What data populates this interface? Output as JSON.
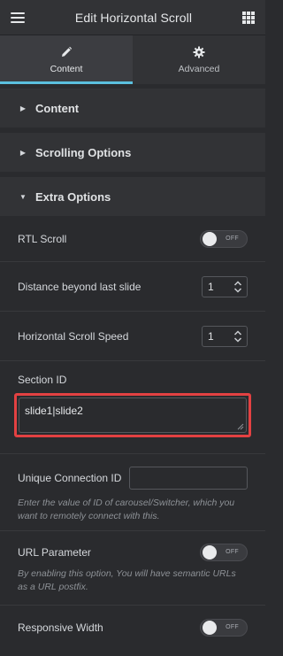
{
  "header": {
    "title": "Edit Horizontal Scroll"
  },
  "tabs": [
    {
      "label": "Content",
      "icon": "pencil-icon",
      "active": true
    },
    {
      "label": "Advanced",
      "icon": "gear-icon",
      "active": false
    }
  ],
  "sections": {
    "content": "Content",
    "scrolling": "Scrolling Options",
    "extra": "Extra Options"
  },
  "controls": {
    "rtl_scroll": {
      "label": "RTL Scroll",
      "state": "OFF"
    },
    "distance": {
      "label": "Distance beyond last slide",
      "value": "1"
    },
    "speed": {
      "label": "Horizontal Scroll Speed",
      "value": "1"
    },
    "section_id": {
      "label": "Section ID",
      "value": "slide1|slide2"
    },
    "unique_connection": {
      "label": "Unique Connection ID",
      "value": "",
      "description": "Enter the value of ID of carousel/Switcher, which you want to remotely connect with this."
    },
    "url_parameter": {
      "label": "URL Parameter",
      "state": "OFF",
      "description": "By enabling this option, You will have semantic URLs as a URL postfix."
    },
    "responsive_width": {
      "label": "Responsive Width",
      "state": "OFF"
    }
  },
  "colors": {
    "accent": "#5bc0de",
    "highlight_border": "#e34142",
    "panel": "#2a2b2e",
    "header": "#323336"
  }
}
